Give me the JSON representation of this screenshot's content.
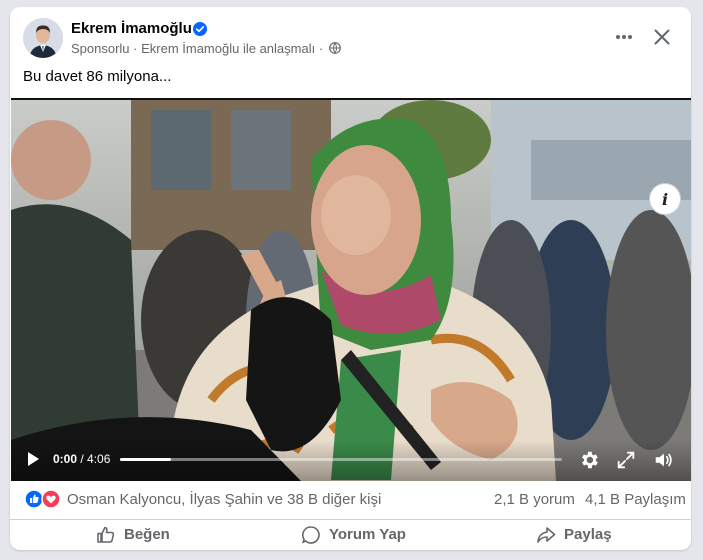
{
  "post": {
    "author": "Ekrem İmamoğlu",
    "meta_text": "Sponsorlu · Ekrem İmamoğlu ile anlaşmalı ·",
    "text": "Bu davet 86 milyona..."
  },
  "video": {
    "current_time": "0:00",
    "separator": " / ",
    "duration": "4:06",
    "progress_fraction": 0.115,
    "info_label": "i"
  },
  "engagement": {
    "reactors_text": "Osman Kalyoncu, İlyas Şahin ve 38 B diğer kişi",
    "comments": "2,1 B yorum",
    "shares": "4,1 B Paylaşım"
  },
  "actions": {
    "like": "Beğen",
    "comment": "Yorum Yap",
    "share": "Paylaş"
  },
  "icons": {
    "verified": "verified-badge-icon",
    "globe": "globe-icon",
    "more": "more-dots-icon",
    "close": "close-icon",
    "play": "play-icon",
    "settings": "gear-icon",
    "fullscreen": "fullscreen-icon",
    "volume": "volume-icon",
    "like_reaction": "like-reaction-icon",
    "love_reaction": "love-reaction-icon"
  },
  "colors": {
    "brand_blue": "#0866ff",
    "love_red": "#f33e58",
    "secondary_text": "#65676b"
  }
}
